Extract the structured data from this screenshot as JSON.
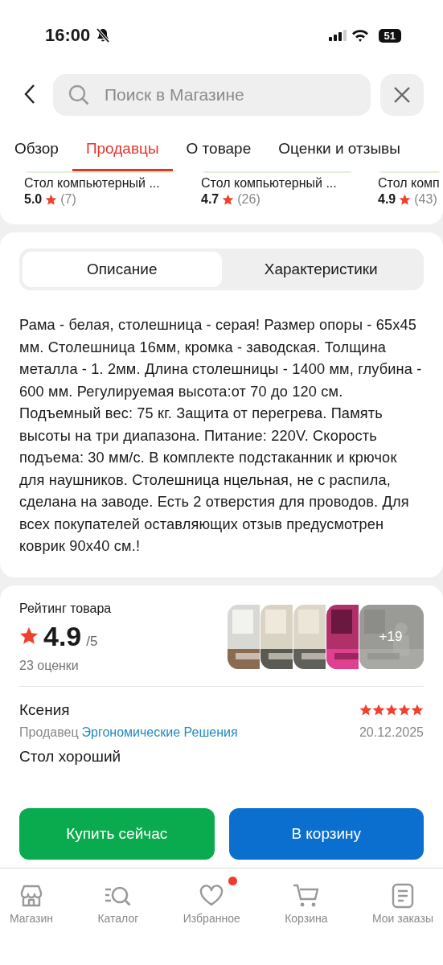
{
  "status_bar": {
    "time": "16:00",
    "silent": true,
    "battery": "51"
  },
  "search": {
    "placeholder": "Поиск в Магазине"
  },
  "tabs": [
    {
      "label": "Обзор",
      "selected": false
    },
    {
      "label": "Продавцы",
      "selected": true
    },
    {
      "label": "О товаре",
      "selected": false
    },
    {
      "label": "Оценки и отзывы",
      "selected": false
    }
  ],
  "offers": [
    {
      "title": "Стол компьютерный ...",
      "rating": "5.0",
      "count": "(7)"
    },
    {
      "title": "Стол компьютерный ...",
      "rating": "4.7",
      "count": "(26)"
    },
    {
      "title": "Стол комп",
      "rating": "4.9",
      "count": "(43)"
    }
  ],
  "segments": [
    {
      "label": "Описание",
      "selected": true
    },
    {
      "label": "Характеристики",
      "selected": false
    }
  ],
  "description": "Рама - белая, столешница - серая! Размер опоры - 65x45 мм. Столешница 16мм, кромка - заводская. Толщина металла - 1. 2мм. Длина столешницы - 1400 мм, глубина - 600 мм. Регулируемая высота:от 70 до 120 см. Подъемный вес: 75 кг. Защита от перегрева. Память высоты на три диапазона. Питание: 220V. Скорость подъема: 30 мм/с. В комплекте подстаканник и крючок для наушников. Столешница нцельная, не с распила, сделана на заводе. Есть 2 отверстия для проводов. Для всех покупателей оставляющих отзыв предусмотрен коврик 90x40 см.!",
  "rating": {
    "title": "Рейтинг товара",
    "value": "4.9",
    "scale": "/5",
    "count": "23 оценки",
    "more_photos": "+19"
  },
  "review": {
    "author": "Ксения",
    "stars": 5,
    "seller_label": "Продавец",
    "seller": "Эргономические Решения",
    "date": "20.12.2025",
    "text": "Стол хороший"
  },
  "actions": [
    {
      "kind": "buy",
      "label": "Купить сейчас"
    },
    {
      "kind": "cart",
      "label": "В корзину"
    }
  ],
  "nav": [
    {
      "kind": "shop",
      "label": "Магазин",
      "badge": false
    },
    {
      "kind": "catalog",
      "label": "Каталог",
      "badge": false
    },
    {
      "kind": "favorites",
      "label": "Избранное",
      "badge": true
    },
    {
      "kind": "cart",
      "label": "Корзина",
      "badge": false
    },
    {
      "kind": "orders",
      "label": "Мои заказы",
      "badge": false
    }
  ]
}
